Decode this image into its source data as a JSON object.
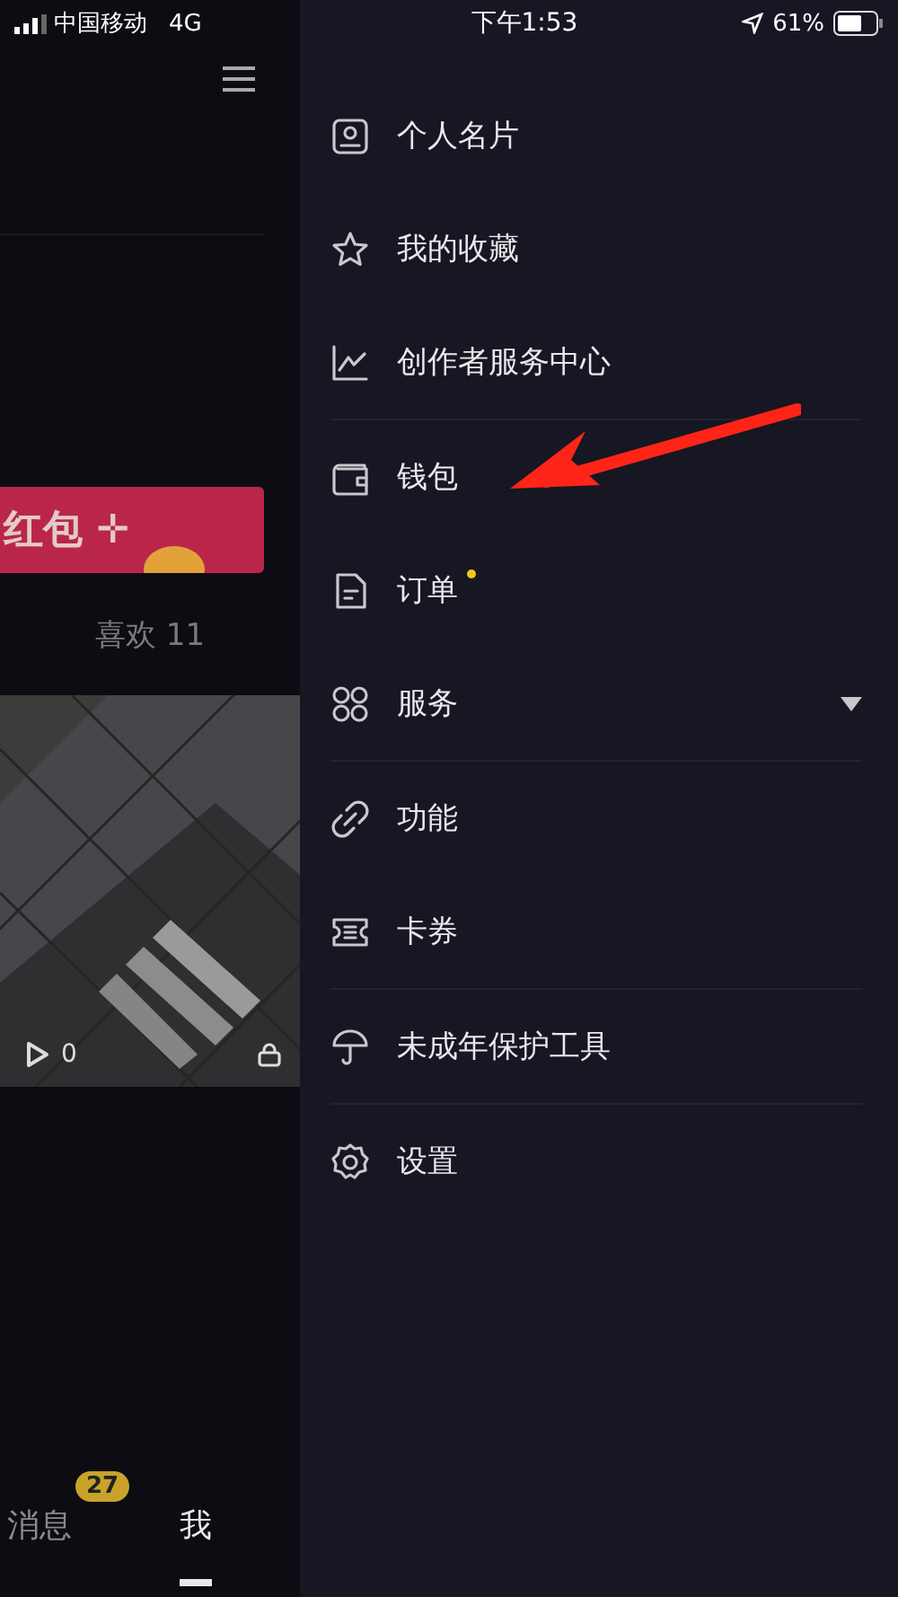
{
  "status_bar": {
    "carrier": "中国移动",
    "network": "4G",
    "time": "下午1:53",
    "battery": "61%"
  },
  "profile_behind": {
    "banner_text": "红包 ✛",
    "likes_tab": "喜欢 11",
    "video": {
      "plays": "0"
    }
  },
  "tab_bar": [
    {
      "label": "消息",
      "badge": "27",
      "selected": false
    },
    {
      "label": "我",
      "selected": true
    }
  ],
  "drawer": {
    "sections": [
      [
        {
          "label": "个人名片",
          "dot": false,
          "caret": false
        },
        {
          "label": "我的收藏",
          "dot": false,
          "caret": false
        },
        {
          "label": "创作者服务中心",
          "dot": false,
          "caret": false
        }
      ],
      [
        {
          "label": "钱包",
          "dot": false,
          "caret": false
        },
        {
          "label": "订单",
          "dot": true,
          "caret": false
        },
        {
          "label": "服务",
          "dot": false,
          "caret": true
        }
      ],
      [
        {
          "label": "功能",
          "dot": false,
          "caret": false
        },
        {
          "label": "卡券",
          "dot": false,
          "caret": false
        }
      ],
      [
        {
          "label": "未成年保护工具",
          "dot": false,
          "caret": false
        }
      ],
      [
        {
          "label": "设置",
          "dot": false,
          "caret": false
        }
      ]
    ]
  }
}
